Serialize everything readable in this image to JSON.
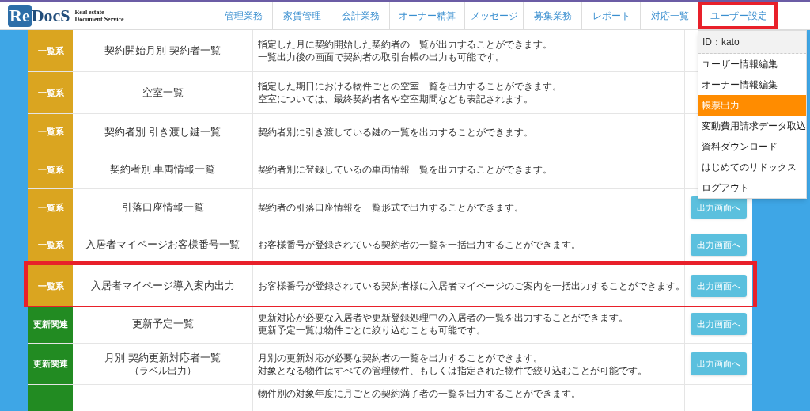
{
  "logo": {
    "mark_re": "Re",
    "mark_docs": "DocS",
    "tagline": [
      "Real estate",
      "Document Service"
    ]
  },
  "nav": [
    {
      "label": "管理業務",
      "highlighted": false
    },
    {
      "label": "家賃管理",
      "highlighted": false
    },
    {
      "label": "会計業務",
      "highlighted": false
    },
    {
      "label": "オーナー精算",
      "highlighted": false
    },
    {
      "label": "メッセージ",
      "highlighted": false
    },
    {
      "label": "募集業務",
      "highlighted": false
    },
    {
      "label": "レポート",
      "highlighted": false
    },
    {
      "label": "対応一覧",
      "highlighted": false
    },
    {
      "label": "ユーザー設定",
      "highlighted": true
    }
  ],
  "user_menu": {
    "id_label": "ID：kato",
    "items": [
      {
        "label": "ユーザー情報編集",
        "selected": false
      },
      {
        "label": "オーナー情報編集",
        "selected": false
      },
      {
        "label": "帳票出力",
        "selected": true
      },
      {
        "label": "変動費用請求データ取込",
        "selected": false
      },
      {
        "label": "資料ダウンロード",
        "selected": false
      },
      {
        "label": "はじめてのリドックス",
        "selected": false
      },
      {
        "label": "ログアウト",
        "selected": false
      }
    ]
  },
  "rows": [
    {
      "kind": "list",
      "category": "一覧系",
      "name": [
        "契約開始月別 契約者一覧"
      ],
      "description": [
        "指定した月に契約開始した契約者の一覧が出力することができます。",
        "一覧出力後の画面で契約者の取引台帳の出力も可能です。"
      ],
      "highlighted": false
    },
    {
      "kind": "list",
      "category": "一覧系",
      "name": [
        "空室一覧"
      ],
      "description": [
        "指定した期日における物件ごとの空室一覧を出力することができます。",
        "空室については、最終契約者名や空室期間なども表記されます。"
      ],
      "highlighted": false
    },
    {
      "kind": "list",
      "category": "一覧系",
      "name": [
        "契約者別 引き渡し鍵一覧"
      ],
      "description": [
        "契約者別に引き渡している鍵の一覧を出力することができます。"
      ],
      "highlighted": false
    },
    {
      "kind": "list",
      "category": "一覧系",
      "name": [
        "契約者別 車両情報一覧"
      ],
      "description": [
        "契約者別に登録しているの車両情報一覧を出力することができます。"
      ],
      "highlighted": false
    },
    {
      "kind": "list",
      "category": "一覧系",
      "name": [
        "引落口座情報一覧"
      ],
      "description": [
        "契約者の引落口座情報を一覧形式で出力することができます。"
      ],
      "button": "出力画面へ",
      "highlighted": false
    },
    {
      "kind": "list",
      "category": "一覧系",
      "name": [
        "入居者マイページお客様番号一覧"
      ],
      "description": [
        "お客様番号が登録されている契約者の一覧を一括出力することができます。"
      ],
      "button": "出力画面へ",
      "highlighted": false
    },
    {
      "kind": "list",
      "category": "一覧系",
      "name": [
        "入居者マイページ導入案内出力"
      ],
      "description": [
        "お客様番号が登録されている契約者様に入居者マイページのご案内を一括出力することができます。"
      ],
      "button": "出力画面へ",
      "highlighted": true
    },
    {
      "kind": "renewal",
      "category": "更新関連",
      "name": [
        "更新予定一覧"
      ],
      "description": [
        "更新対応が必要な入居者や更新登録処理中の入居者の一覧を出力することができます。",
        "更新予定一覧は物件ごとに絞り込むことも可能です。"
      ],
      "button": "出力画面へ",
      "highlighted": false
    },
    {
      "kind": "renewal",
      "category": "更新関連",
      "name": [
        "月別 契約更新対応者一覧",
        "（ラベル出力）"
      ],
      "description": [
        "月別の更新対応が必要な契約者の一覧を出力することができます。",
        "対象となる物件はすべての管理物件、もしくは指定された物件で絞り込むことが可能です。"
      ],
      "button": "出力画面へ",
      "highlighted": false
    },
    {
      "kind": "renewal",
      "description": [
        "物件別の対象年度に月ごとの契約満了者の一覧を出力することができます。"
      ],
      "highlighted": false
    }
  ]
}
